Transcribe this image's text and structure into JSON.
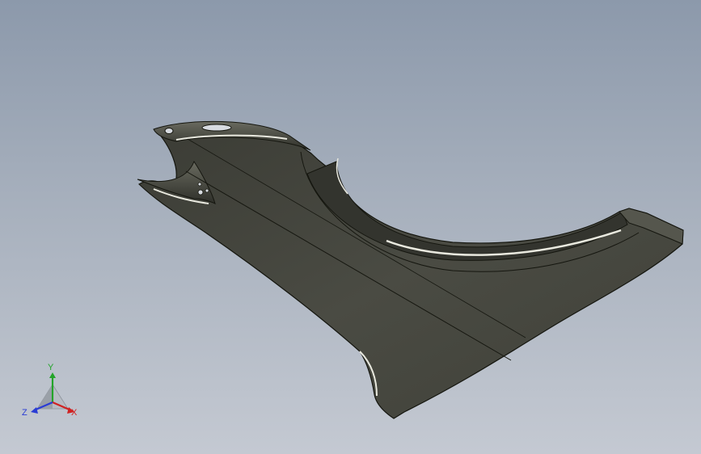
{
  "viewport": {
    "background_top": "#8c99ab",
    "background_bottom": "#c4c9d2",
    "model": {
      "description_icon": "cad-sheet-metal-fender-part",
      "body_color": "#45463e",
      "edge_color": "#15160f",
      "highlight_color": "#e9e9df"
    }
  },
  "triad": {
    "x_label": "X",
    "y_label": "Y",
    "z_label": "Z",
    "x_color": "#d02222",
    "y_color": "#24a42a",
    "z_color": "#2a3cd4"
  }
}
